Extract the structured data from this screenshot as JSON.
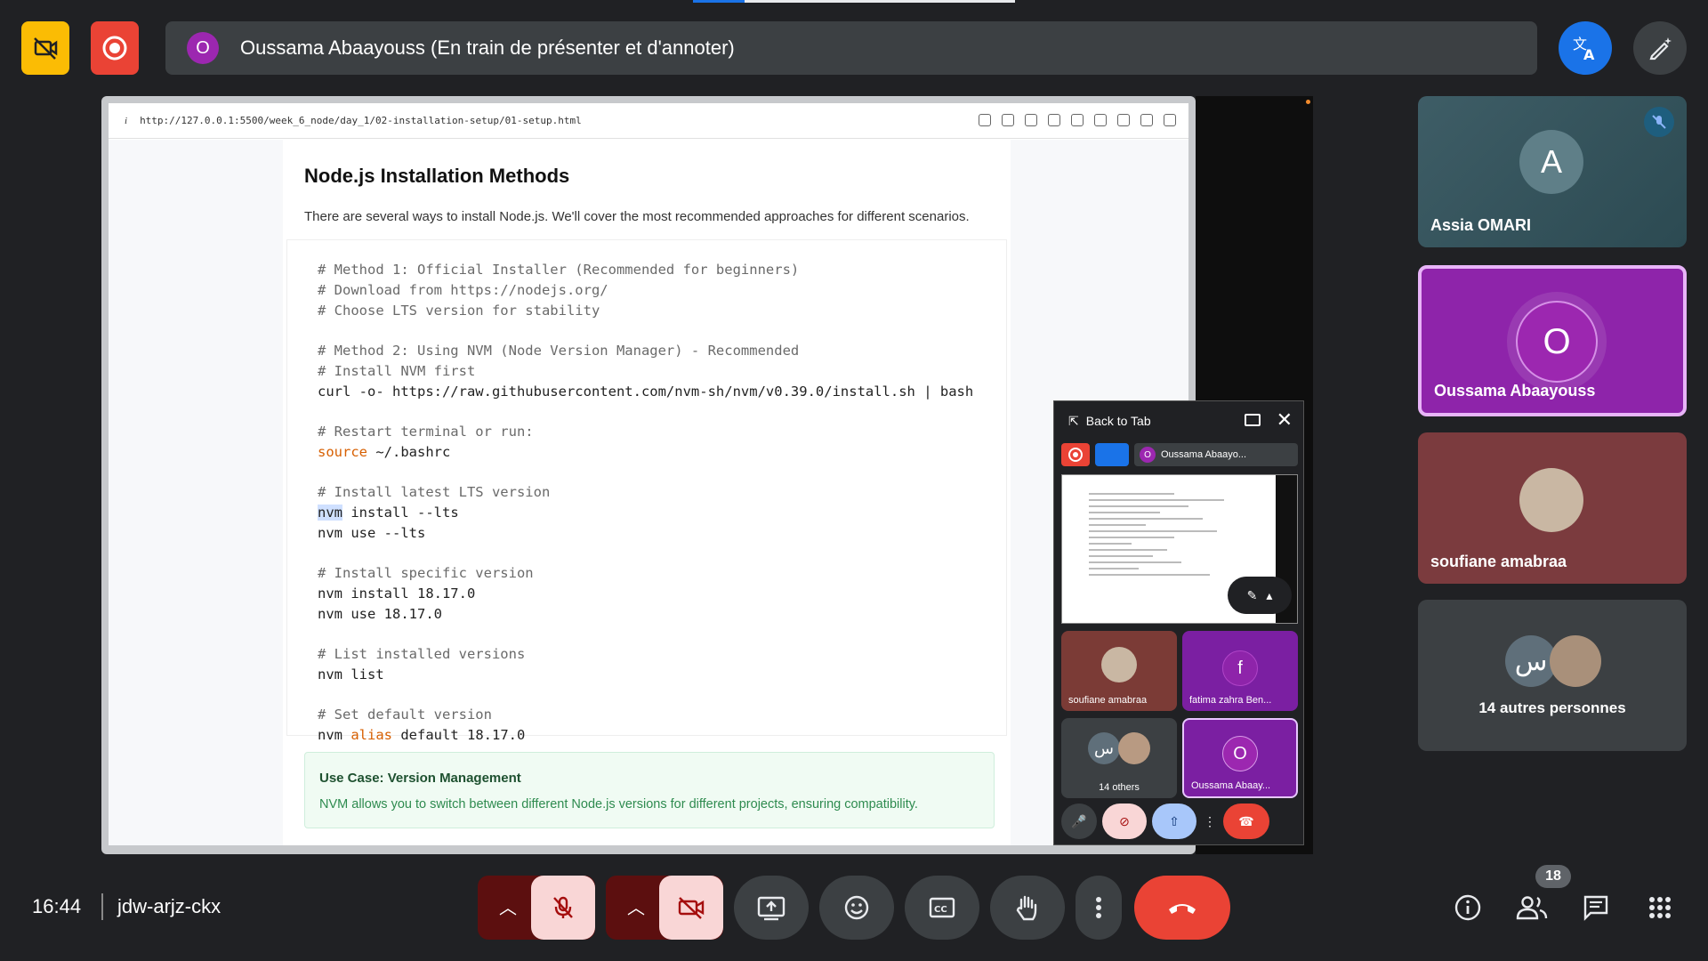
{
  "top_bar": {
    "presenter_avatar_letter": "O",
    "presenter_label": "Oussama Abaayouss (En train de présenter et d'annoter)"
  },
  "browser": {
    "url": "http://127.0.0.1:5500/week_6_node/day_1/02-installation-setup/01-setup.html",
    "info_icon": "i"
  },
  "doc": {
    "title": "Node.js Installation Methods",
    "intro": "There are several ways to install Node.js. We'll cover the most recommended approaches for different scenarios.",
    "code_lines": [
      "# Method 1: Official Installer (Recommended for beginners)",
      "# Download from https://nodejs.org/",
      "# Choose LTS version for stability",
      "# Method 2: Using NVM (Node Version Manager) - Recommended",
      "# Install NVM first",
      "curl -o- https://raw.githubusercontent.com/nvm-sh/nvm/v0.39.0/install.sh | bash",
      "# Restart terminal or run:",
      "source",
      " ~/.bashrc",
      "# Install latest LTS version",
      "nvm",
      " install --lts",
      "nvm use --lts",
      "# Install specific version",
      "nvm install 18.17.0",
      "nvm use 18.17.0",
      "# List installed versions",
      "nvm list",
      "# Set default version",
      "nvm ",
      "alias",
      " default 18.17.0"
    ],
    "use_case_title": "Use Case: Version Management",
    "use_case_text": "NVM allows you to switch between different Node.js versions for different projects, ensuring compatibility."
  },
  "pip": {
    "back_label": "Back to Tab",
    "mini_presenter": "Oussama Abaayo...",
    "mini_avatar": "O",
    "tiles": [
      {
        "name": "soufiane amabraa"
      },
      {
        "name": "fatima zahra Ben...",
        "letter": "f"
      },
      {
        "name": "14 others",
        "letter": "س"
      },
      {
        "name": "Oussama Abaay...",
        "letter": "O"
      }
    ]
  },
  "participants": [
    {
      "name": "Assia OMARI",
      "letter": "A"
    },
    {
      "name": "Oussama Abaayouss",
      "letter": "O"
    },
    {
      "name": "soufiane amabraa"
    },
    {
      "name": "14 autres personnes",
      "letter": "س"
    }
  ],
  "bottom_bar": {
    "time": "16:44",
    "meeting_code": "jdw-arjz-ckx",
    "participant_count": "18"
  },
  "progress": 0.16,
  "colors": {
    "accent_blue": "#1a73e8",
    "record_red": "#ea4335",
    "camera_off_yellow": "#fbbc04",
    "presenter_purple": "#9c27b0",
    "end_call_red": "#ea4335"
  }
}
